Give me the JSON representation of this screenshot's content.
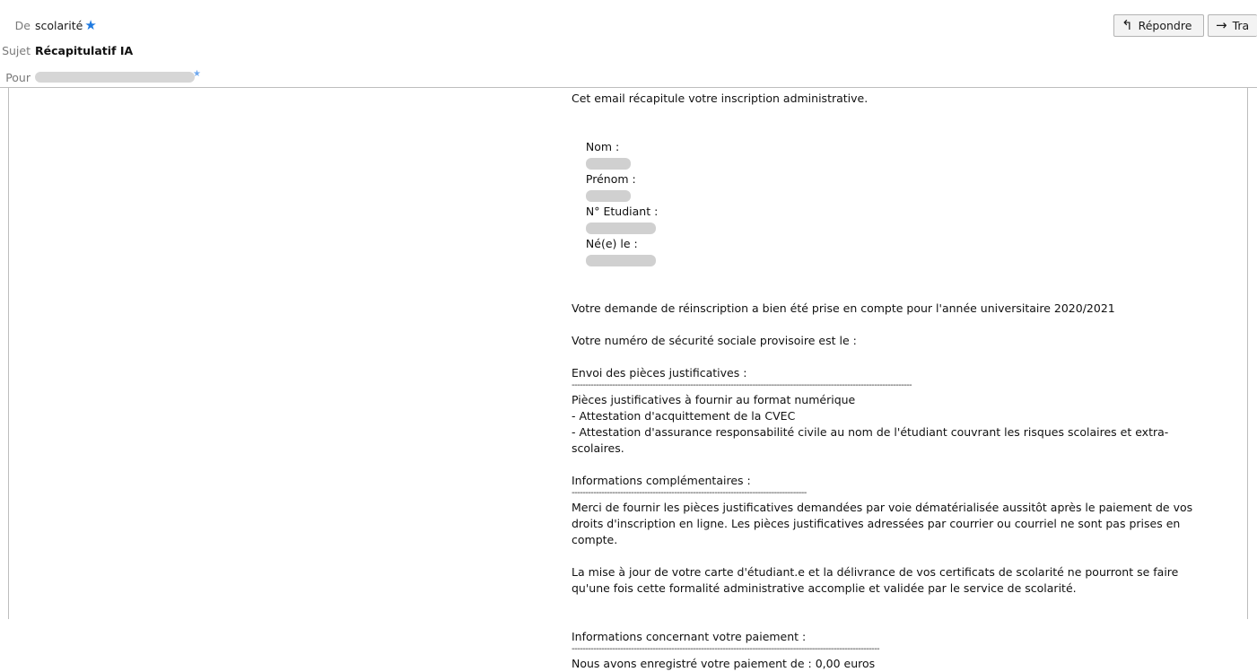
{
  "header": {
    "from_label": "De",
    "from_name": "scolarité",
    "subject_label": "Sujet",
    "subject": "Récapitulatif IA",
    "to_label": "Pour"
  },
  "toolbar": {
    "reply_label": "Répondre",
    "forward_label": "Tra"
  },
  "message": {
    "intro": "Cet email récapitule votre inscription administrative.",
    "nom_label": "Nom :",
    "prenom_label": "Prénom :",
    "etudiant_label": "N° Etudiant :",
    "nele_label": "Né(e) le :",
    "reinscription": "Votre demande de réinscription a bien été prise en compte pour l'année universitaire 2020/2021",
    "secu": "Votre numéro de sécurité sociale provisoire est le :",
    "envoi_title": "Envoi des pièces justificatives :",
    "pieces_title": "Pièces justificatives à fournir au format numérique",
    "piece_1": "- Attestation d'acquittement de la CVEC",
    "piece_2": "- Attestation d'assurance responsabilité civile au nom de l'étudiant couvrant les risques scolaires et extra-scolaires.",
    "infos_title": "Informations complémentaires :",
    "infos_p1": "Merci de fournir les pièces justificatives demandées par voie dématérialisée aussitôt après le paiement de vos droits d'inscription en ligne. Les pièces justificatives adressées par courrier ou courriel ne sont pas prises en compte.",
    "infos_p2": "La mise à jour de votre carte d'étudiant.e et la délivrance de vos certificats de scolarité ne pourront se faire qu'une fois cette formalité administrative accomplie et validée par le service de scolarité.",
    "paiement_title": "Informations concernant votre paiement :",
    "paiement_text": "Nous avons enregistré votre paiement de : 0,00 euros"
  },
  "colors": {
    "star": "#1f7ae0",
    "border": "#bdbdbd",
    "button_bg": "#f3f3f3"
  },
  "icons": {
    "reply": "reply-icon",
    "forward": "forward-icon",
    "star": "star-icon"
  }
}
